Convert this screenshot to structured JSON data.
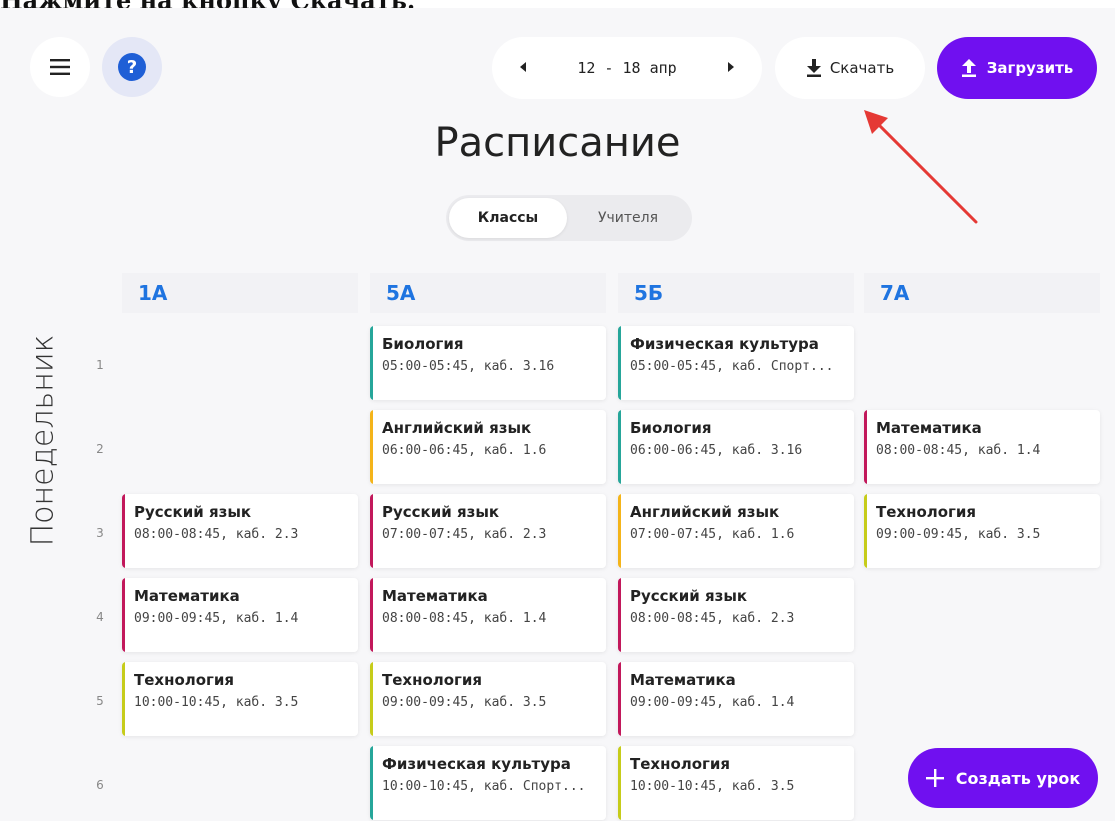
{
  "caption": "Нажмите на кнопку Скачать.",
  "toolbar": {
    "week_range": "12 - 18 апр",
    "download_label": "Скачать",
    "upload_label": "Загрузить",
    "help_label": "?"
  },
  "page": {
    "title": "Расписание",
    "toggle": {
      "active": "Классы",
      "inactive": "Учителя"
    },
    "day": "Понедельник",
    "create_label": "Создать урок"
  },
  "classes": [
    "1А",
    "5А",
    "5Б",
    "7А"
  ],
  "periods": [
    "1",
    "2",
    "3",
    "4",
    "5",
    "6"
  ],
  "lessons": [
    {
      "class": 0,
      "period": 3,
      "subject": "Русский язык",
      "meta": "08:00-08:45, каб. 2.3",
      "color": "#c2185b"
    },
    {
      "class": 0,
      "period": 4,
      "subject": "Математика",
      "meta": "09:00-09:45, каб. 1.4",
      "color": "#c2185b"
    },
    {
      "class": 0,
      "period": 5,
      "subject": "Технология",
      "meta": "10:00-10:45, каб. 3.5",
      "color": "#c6cc1a"
    },
    {
      "class": 1,
      "period": 1,
      "subject": "Биология",
      "meta": "05:00-05:45, каб. 3.16",
      "color": "#26a69a"
    },
    {
      "class": 1,
      "period": 2,
      "subject": "Английский язык",
      "meta": "06:00-06:45, каб. 1.6",
      "color": "#f4b41a"
    },
    {
      "class": 1,
      "period": 3,
      "subject": "Русский язык",
      "meta": "07:00-07:45, каб. 2.3",
      "color": "#c2185b"
    },
    {
      "class": 1,
      "period": 4,
      "subject": "Математика",
      "meta": "08:00-08:45, каб. 1.4",
      "color": "#c2185b"
    },
    {
      "class": 1,
      "period": 5,
      "subject": "Технология",
      "meta": "09:00-09:45, каб. 3.5",
      "color": "#c6cc1a"
    },
    {
      "class": 1,
      "period": 6,
      "subject": "Физическая культура",
      "meta": "10:00-10:45, каб. Спорт...",
      "color": "#26a69a"
    },
    {
      "class": 2,
      "period": 1,
      "subject": "Физическая культура",
      "meta": "05:00-05:45, каб. Спорт...",
      "color": "#26a69a"
    },
    {
      "class": 2,
      "period": 2,
      "subject": "Биология",
      "meta": "06:00-06:45, каб. 3.16",
      "color": "#26a69a"
    },
    {
      "class": 2,
      "period": 3,
      "subject": "Английский язык",
      "meta": "07:00-07:45, каб. 1.6",
      "color": "#f4b41a"
    },
    {
      "class": 2,
      "period": 4,
      "subject": "Русский язык",
      "meta": "08:00-08:45, каб. 2.3",
      "color": "#c2185b"
    },
    {
      "class": 2,
      "period": 5,
      "subject": "Математика",
      "meta": "09:00-09:45, каб. 1.4",
      "color": "#c2185b"
    },
    {
      "class": 2,
      "period": 6,
      "subject": "Технология",
      "meta": "10:00-10:45, каб. 3.5",
      "color": "#c6cc1a"
    },
    {
      "class": 3,
      "period": 2,
      "subject": "Математика",
      "meta": "08:00-08:45, каб. 1.4",
      "color": "#c2185b"
    },
    {
      "class": 3,
      "period": 3,
      "subject": "Технология",
      "meta": "09:00-09:45, каб. 3.5",
      "color": "#c6cc1a"
    }
  ],
  "colors": {
    "accent": "#7010f0",
    "class_heading": "#1f74e0",
    "annotation": "#e53935"
  },
  "icons": [
    "menu-icon",
    "help-icon",
    "chevron-left-icon",
    "chevron-right-icon",
    "download-icon",
    "upload-icon",
    "plus-icon"
  ]
}
